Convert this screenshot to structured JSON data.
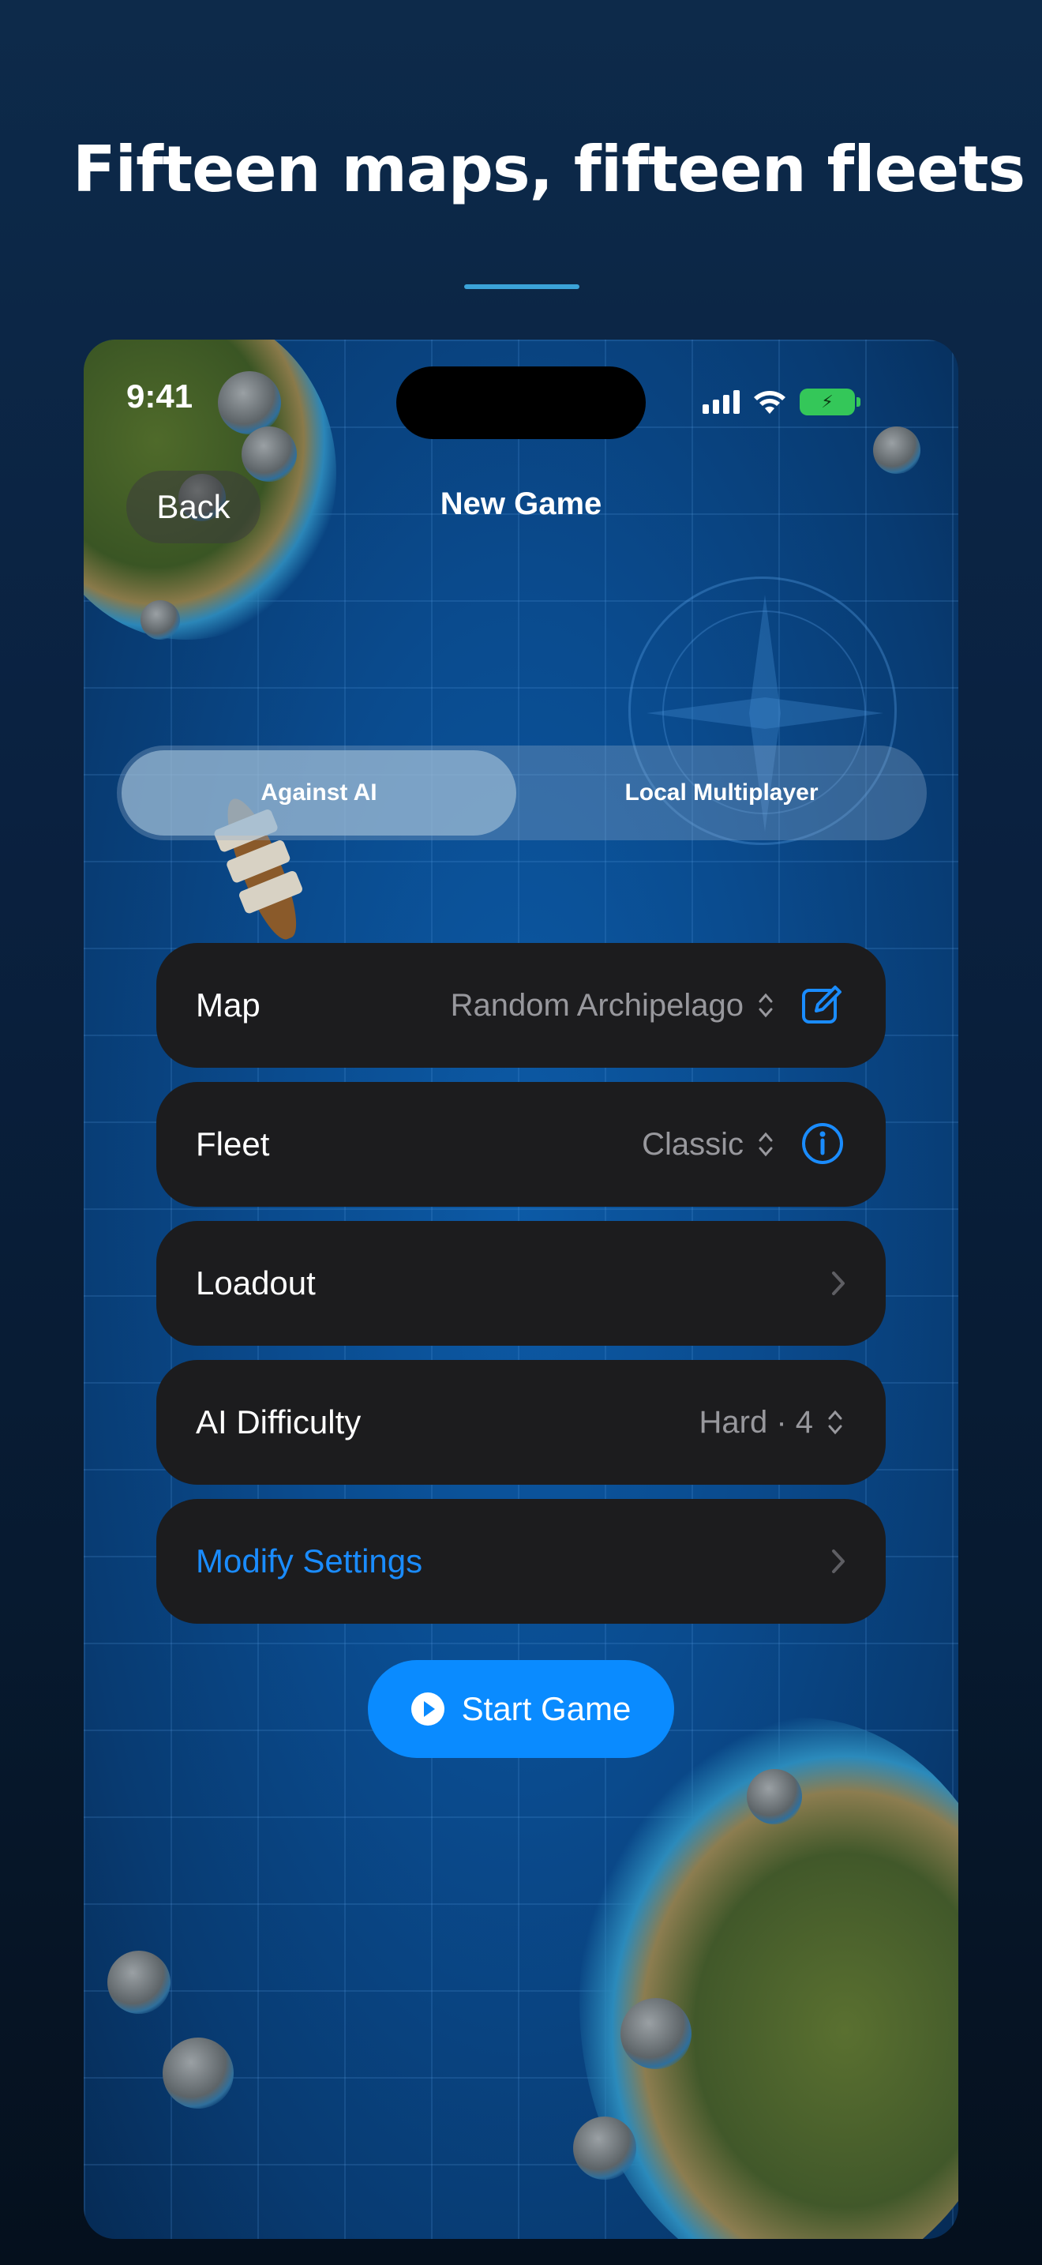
{
  "headline": "Fifteen maps, fifteen fleets",
  "status_bar": {
    "time": "9:41",
    "battery_glyph": "⚡"
  },
  "nav": {
    "back_label": "Back",
    "title": "New Game"
  },
  "mode_segment": {
    "options": [
      "Against AI",
      "Local Multiplayer"
    ],
    "selected": "Against AI"
  },
  "settings": {
    "map": {
      "label": "Map",
      "value": "Random Archipelago",
      "action_icon": "edit-icon"
    },
    "fleet": {
      "label": "Fleet",
      "value": "Classic",
      "action_icon": "info-icon"
    },
    "loadout": {
      "label": "Loadout"
    },
    "ai_difficulty": {
      "label": "AI Difficulty",
      "value": "Hard · 4"
    },
    "modify": {
      "label": "Modify Settings"
    }
  },
  "start_button": {
    "label": "Start Game",
    "icon": "play-icon"
  },
  "colors": {
    "accent": "#0a8bff",
    "row_bg": "#1c1c1e",
    "link": "#1a8cff",
    "divider": "#3ba3d8"
  }
}
